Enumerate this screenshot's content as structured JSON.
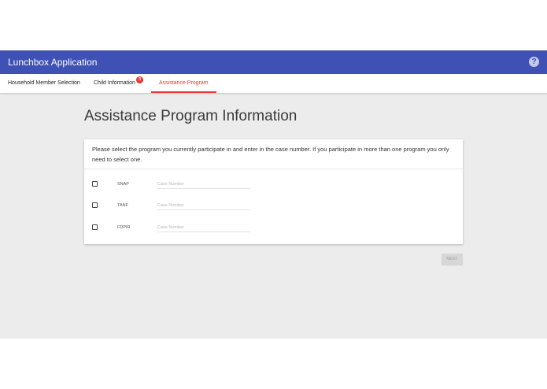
{
  "appbar": {
    "title": "Lunchbox Application",
    "help_icon": "?"
  },
  "tabs": [
    {
      "label": "Household Member Selection",
      "active": false
    },
    {
      "label": "Child Information",
      "active": false,
      "badge": "3"
    },
    {
      "label": "Assistance Program",
      "active": true
    }
  ],
  "main": {
    "title": "Assistance Program Information",
    "instructions": "Please select the program you currently participate in and enter in the case number. If you participate in more than one program you only need to select one.",
    "programs": [
      {
        "label": "SNAP",
        "placeholder": "Case Number",
        "checked": false
      },
      {
        "label": "TANF",
        "placeholder": "Case Number",
        "checked": false
      },
      {
        "label": "FDPIR",
        "placeholder": "Case Number",
        "checked": false
      }
    ],
    "next_label": "NEXT"
  },
  "colors": {
    "appbar": "#3f51b5",
    "accent": "#e53935",
    "background": "#ececec"
  }
}
